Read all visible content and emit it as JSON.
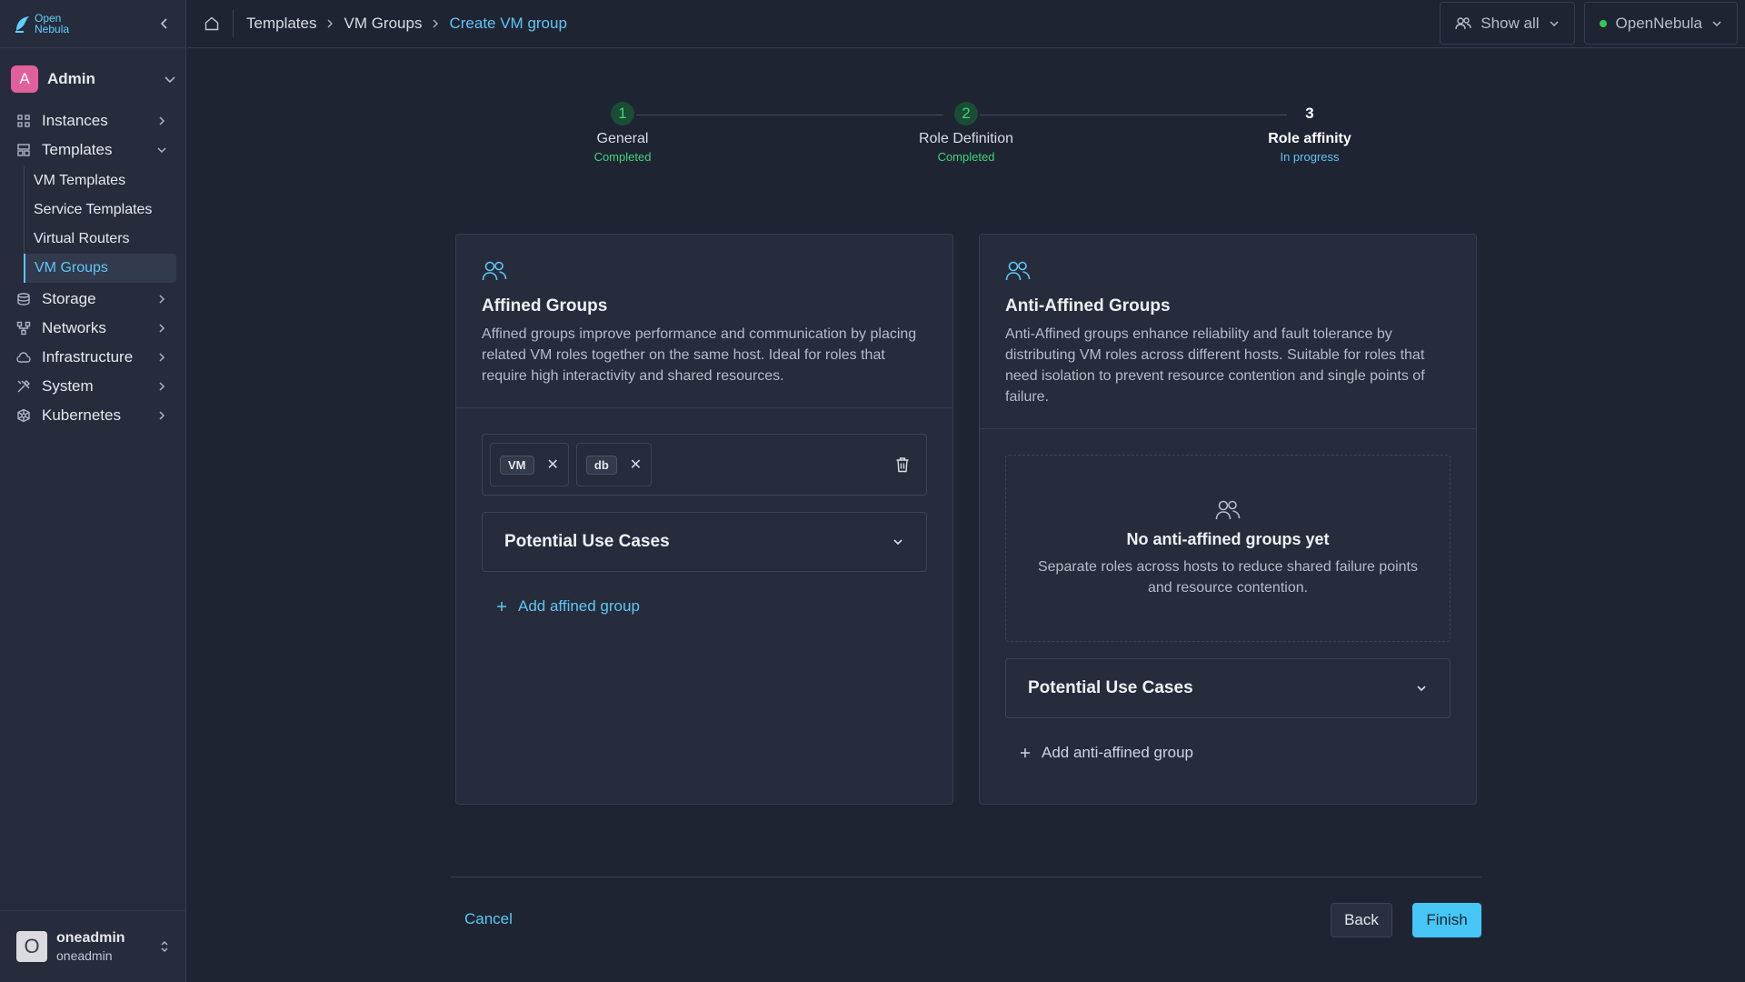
{
  "brand": {
    "line1": "Open",
    "line2": "Nebula",
    "accent": "#5fc6f4"
  },
  "sidebar": {
    "user_switch": {
      "initial": "A",
      "label": "Admin"
    },
    "items": [
      {
        "label": "Instances",
        "icon": "instances-icon"
      },
      {
        "label": "Templates",
        "icon": "templates-icon",
        "expanded": true
      },
      {
        "label": "Storage",
        "icon": "storage-icon"
      },
      {
        "label": "Networks",
        "icon": "networks-icon"
      },
      {
        "label": "Infrastructure",
        "icon": "cloud-icon"
      },
      {
        "label": "System",
        "icon": "system-icon"
      },
      {
        "label": "Kubernetes",
        "icon": "kubernetes-icon"
      }
    ],
    "templates_sub": [
      {
        "label": "VM Templates"
      },
      {
        "label": "Service Templates"
      },
      {
        "label": "Virtual Routers"
      },
      {
        "label": "VM Groups",
        "active": true
      }
    ],
    "footer_user": {
      "initial": "O",
      "name": "oneadmin",
      "sub": "oneadmin"
    }
  },
  "header": {
    "breadcrumb": [
      "Templates",
      "VM Groups",
      "Create VM group"
    ],
    "show_all": "Show all",
    "zone": "OpenNebula",
    "zone_status_color": "#33c758"
  },
  "stepper": [
    {
      "num": "1",
      "title": "General",
      "status": "Completed"
    },
    {
      "num": "2",
      "title": "Role Definition",
      "status": "Completed"
    },
    {
      "num": "3",
      "title": "Role affinity",
      "status": "In progress"
    }
  ],
  "affined": {
    "title": "Affined Groups",
    "description": "Affined groups improve performance and communication by placing related VM roles together on the same host. Ideal for roles that require high interactivity and shared resources.",
    "groups": [
      {
        "roles": [
          "VM",
          "db"
        ]
      }
    ],
    "use_cases": "Potential Use Cases",
    "add_label": "Add affined group"
  },
  "anti_affined": {
    "title": "Anti-Affined Groups",
    "description": "Anti-Affined groups enhance reliability and fault tolerance by distributing VM roles across different hosts. Suitable for roles that need isolation to prevent resource contention and single points of failure.",
    "empty_title": "No anti-affined groups yet",
    "empty_desc": "Separate roles across hosts to reduce shared failure points and resource contention.",
    "use_cases": "Potential Use Cases",
    "add_label": "Add anti-affined group"
  },
  "actions": {
    "cancel": "Cancel",
    "back": "Back",
    "finish": "Finish"
  }
}
